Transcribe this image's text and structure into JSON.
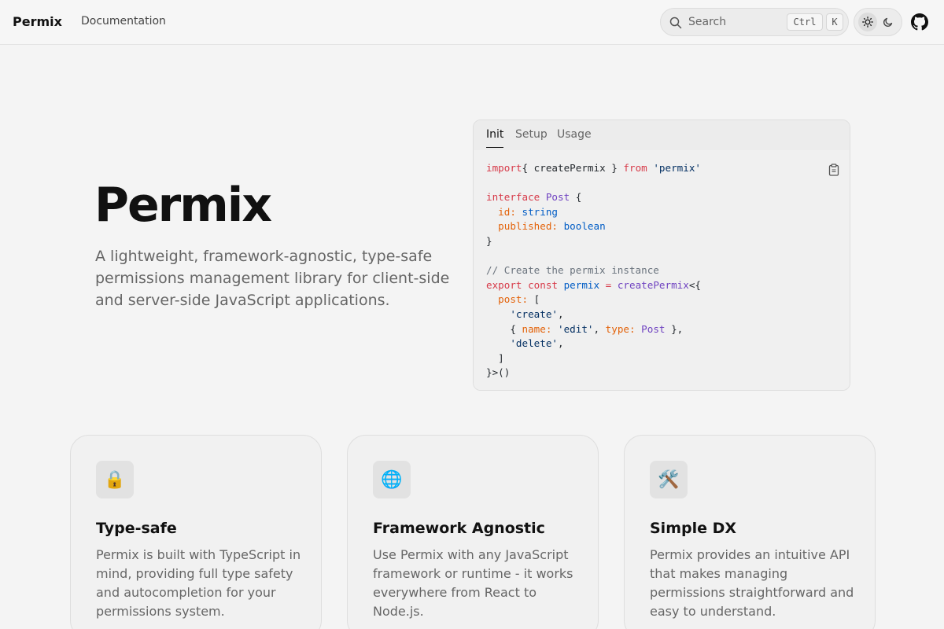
{
  "nav": {
    "brand": "Permix",
    "documentation": "Documentation",
    "search_placeholder": "Search",
    "kbd_ctrl": "Ctrl",
    "kbd_k": "K"
  },
  "hero": {
    "title": "Permix",
    "description": "A lightweight, framework-agnostic, type-safe permissions management library for client-side and server-side JavaScript applications."
  },
  "code_card": {
    "tabs": [
      {
        "label": "Init",
        "active": true
      },
      {
        "label": "Setup",
        "active": false
      },
      {
        "label": "Usage",
        "active": false
      }
    ],
    "code_lines": [
      [
        [
          "kw",
          "import"
        ],
        [
          "",
          "{ createPermix } "
        ],
        [
          "kw",
          "from"
        ],
        [
          "st",
          " 'permix'"
        ]
      ],
      [],
      [
        [
          "kw",
          "interface"
        ],
        [
          "ty",
          " Post"
        ],
        [
          "",
          " {"
        ]
      ],
      [
        [
          "",
          "  "
        ],
        [
          "pr",
          "id:"
        ],
        [
          "bu",
          " string"
        ]
      ],
      [
        [
          "",
          "  "
        ],
        [
          "pr",
          "published:"
        ],
        [
          "bu",
          " boolean"
        ]
      ],
      [
        [
          "",
          "}"
        ]
      ],
      [],
      [
        [
          "cm",
          "// Create the permix instance"
        ]
      ],
      [
        [
          "kw",
          "export"
        ],
        [
          "kw",
          " const"
        ],
        [
          "bu",
          " permix"
        ],
        [
          "kw",
          " ="
        ],
        [
          "ty",
          " createPermix"
        ],
        [
          "",
          "<{"
        ]
      ],
      [
        [
          "",
          "  "
        ],
        [
          "pr",
          "post:"
        ],
        [
          "",
          " ["
        ]
      ],
      [
        [
          "",
          "    "
        ],
        [
          "st",
          "'create'"
        ],
        [
          "",
          ","
        ]
      ],
      [
        [
          "",
          "    { "
        ],
        [
          "pr",
          "name:"
        ],
        [
          "st",
          " 'edit'"
        ],
        [
          "",
          ", "
        ],
        [
          "pr",
          "type:"
        ],
        [
          "ty",
          " Post"
        ],
        [
          "",
          " },"
        ]
      ],
      [
        [
          "",
          "    "
        ],
        [
          "st",
          "'delete'"
        ],
        [
          "",
          ","
        ]
      ],
      [
        [
          "",
          "  ]"
        ]
      ],
      [
        [
          "",
          "}>()"
        ]
      ]
    ]
  },
  "features": [
    {
      "icon": "🔒",
      "icon_name": "lock-icon",
      "title": "Type-safe",
      "description": "Permix is built with TypeScript in mind, providing full type safety and autocompletion for your permissions system."
    },
    {
      "icon": "🌐",
      "icon_name": "globe-icon",
      "title": "Framework Agnostic",
      "description": "Use Permix with any JavaScript framework or runtime - it works everywhere from React to Node.js."
    },
    {
      "icon": "🛠️",
      "icon_name": "tools-icon",
      "title": "Simple DX",
      "description": "Permix provides an intuitive API that makes managing permissions straightforward and easy to understand."
    }
  ]
}
